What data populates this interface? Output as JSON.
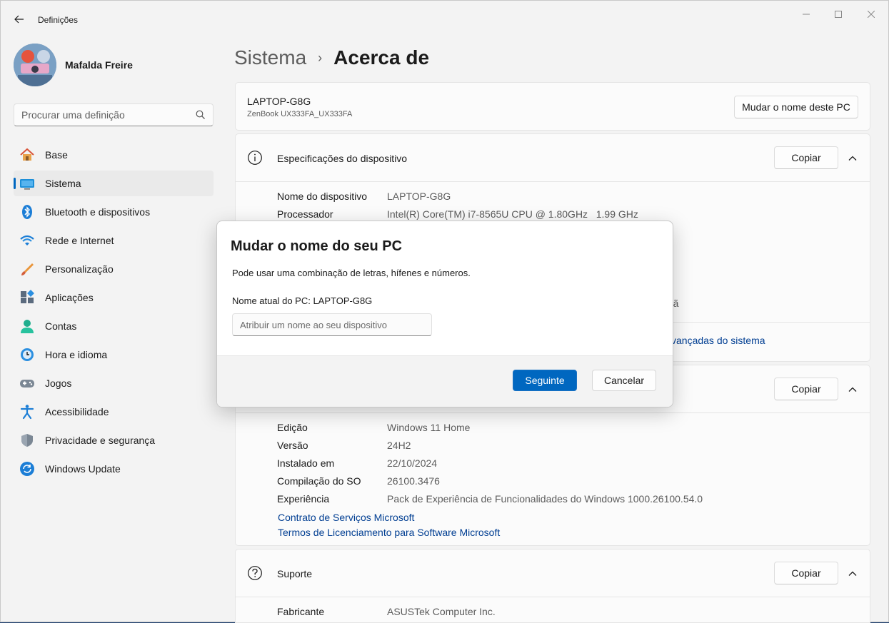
{
  "app": {
    "title": "Definições"
  },
  "profile": {
    "name": "Mafalda Freire"
  },
  "search": {
    "placeholder": "Procurar uma definição"
  },
  "sidebar": {
    "items": [
      {
        "label": "Base",
        "icon": "home-icon"
      },
      {
        "label": "Sistema",
        "icon": "system-icon",
        "active": true
      },
      {
        "label": "Bluetooth e dispositivos",
        "icon": "bluetooth-icon"
      },
      {
        "label": "Rede e Internet",
        "icon": "wifi-icon"
      },
      {
        "label": "Personalização",
        "icon": "brush-icon"
      },
      {
        "label": "Aplicações",
        "icon": "apps-icon"
      },
      {
        "label": "Contas",
        "icon": "account-icon"
      },
      {
        "label": "Hora e idioma",
        "icon": "clock-globe-icon"
      },
      {
        "label": "Jogos",
        "icon": "gamepad-icon"
      },
      {
        "label": "Acessibilidade",
        "icon": "accessibility-icon"
      },
      {
        "label": "Privacidade e segurança",
        "icon": "shield-icon"
      },
      {
        "label": "Windows Update",
        "icon": "update-icon"
      }
    ]
  },
  "breadcrumb": {
    "parent": "Sistema",
    "separator": "›",
    "current": "Acerca de"
  },
  "pc_card": {
    "name": "LAPTOP-G8G",
    "model": "ZenBook UX333FA_UX333FA",
    "rename_button": "Mudar o nome deste PC"
  },
  "device_specs": {
    "title": "Especificações do dispositivo",
    "copy_button": "Copiar",
    "rows": [
      {
        "label": "Nome do dispositivo",
        "value": "LAPTOP-G8G"
      },
      {
        "label": "Processador",
        "value": "Intel(R) Core(TM) i7-8565U CPU @ 1.80GHz   1.99 GHz"
      }
    ],
    "partial_text": "rã",
    "partial_link": "vançadas do sistema"
  },
  "windows_specs": {
    "copy_button": "Copiar",
    "rows": [
      {
        "label": "Edição",
        "value": "Windows 11 Home"
      },
      {
        "label": "Versão",
        "value": "24H2"
      },
      {
        "label": "Instalado em",
        "value": "22/10/2024"
      },
      {
        "label": "Compilação do SO",
        "value": "26100.3476"
      },
      {
        "label": "Experiência",
        "value": "Pack de Experiência de Funcionalidades do Windows 1000.26100.54.0"
      }
    ],
    "links": [
      "Contrato de Serviços Microsoft",
      "Termos de Licenciamento para Software Microsoft"
    ]
  },
  "support": {
    "title": "Suporte",
    "copy_button": "Copiar",
    "rows": [
      {
        "label": "Fabricante",
        "value": "ASUSTek Computer Inc."
      }
    ]
  },
  "dialog": {
    "title": "Mudar o nome do seu PC",
    "description": "Pode usar uma combinação de letras, hífenes e números.",
    "current_name": "Nome atual do PC: LAPTOP-G8G",
    "input_placeholder": "Atribuir um nome ao seu dispositivo",
    "next_button": "Seguinte",
    "cancel_button": "Cancelar"
  },
  "colors": {
    "accent": "#0067c0",
    "link": "#003e92",
    "background": "#f3f3f3",
    "card": "#fbfbfb"
  }
}
